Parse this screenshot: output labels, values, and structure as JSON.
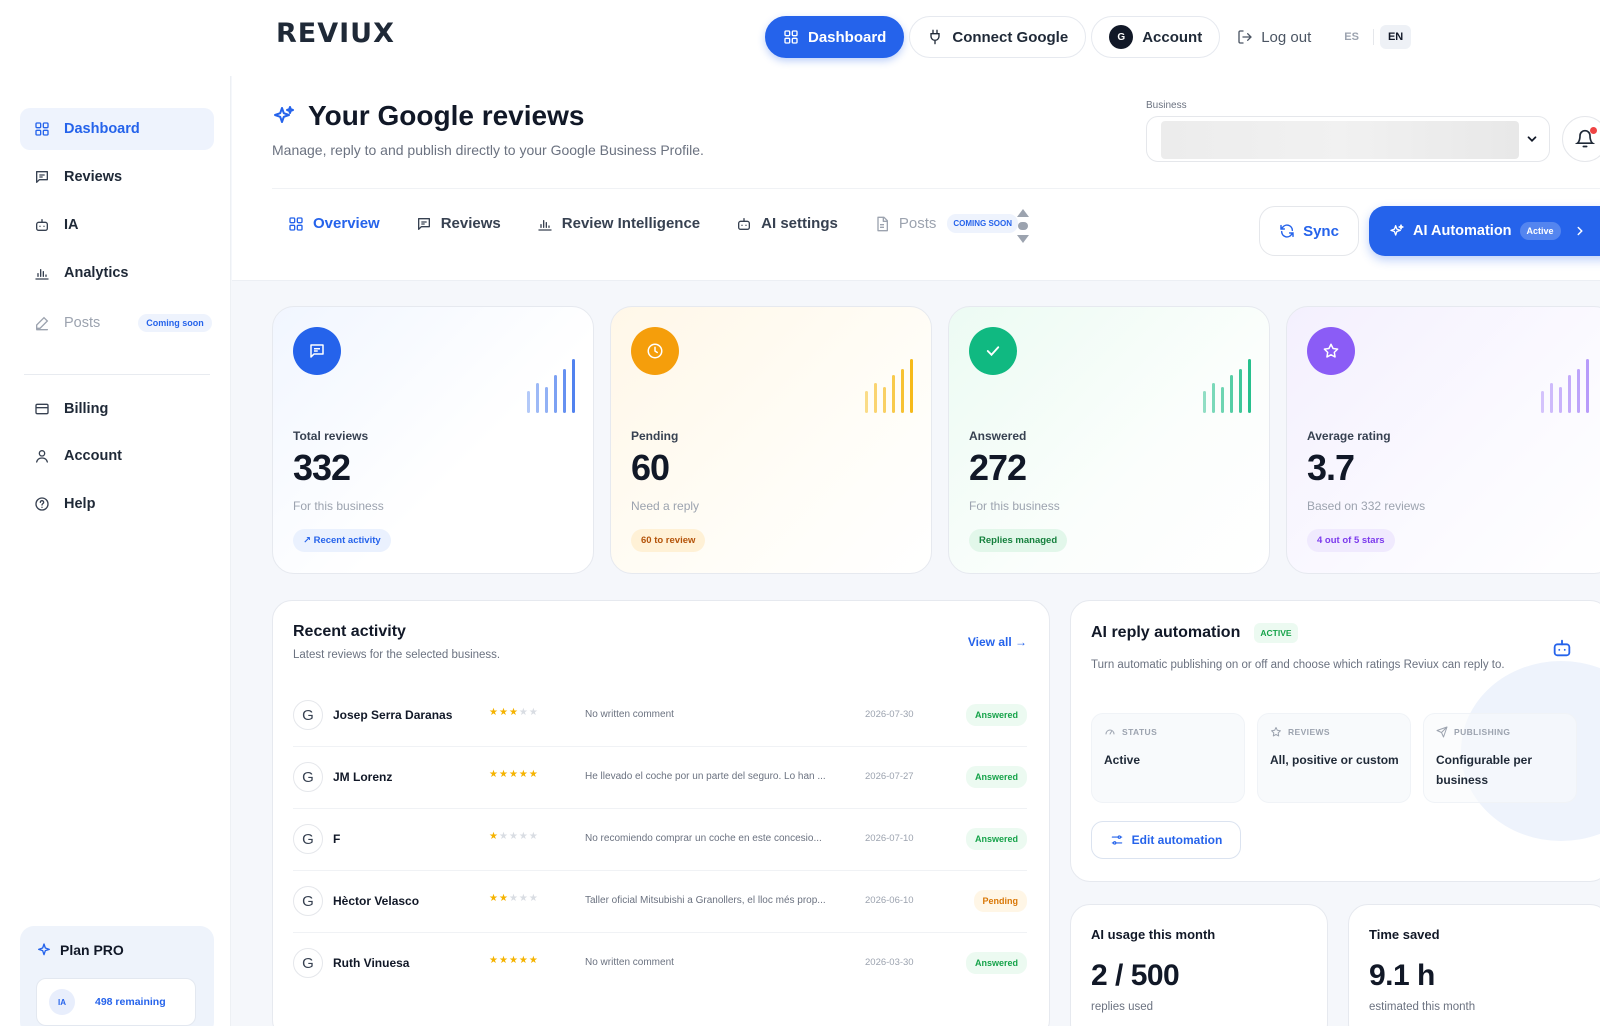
{
  "brand": {
    "logo": "REVIUX"
  },
  "topnav": {
    "dashboard": "Dashboard",
    "connect": "Connect Google",
    "account_avatar": "G",
    "account": "Account",
    "logout": "Log out",
    "lang_es": "ES",
    "lang_en": "EN",
    "active_lang": "EN"
  },
  "sidebar": {
    "items": [
      {
        "label": "Dashboard",
        "icon": "grid-icon",
        "active": true
      },
      {
        "label": "Reviews",
        "icon": "message-icon"
      },
      {
        "label": "IA",
        "icon": "robot-icon"
      },
      {
        "label": "Analytics",
        "icon": "bar-chart-icon"
      },
      {
        "label": "Posts",
        "icon": "pen-icon",
        "badge": "Coming soon",
        "disabled": true
      },
      {
        "label": "Billing",
        "icon": "card-icon"
      },
      {
        "label": "Account",
        "icon": "user-icon"
      },
      {
        "label": "Help",
        "icon": "help-icon"
      }
    ],
    "plan": {
      "title": "Plan PRO",
      "chip": "IA",
      "remaining": "498 remaining"
    }
  },
  "header": {
    "title": "Your Google reviews",
    "subtitle": "Manage, reply to and publish directly to your Google Business Profile.",
    "business_label": "Business"
  },
  "tabs": [
    {
      "label": "Overview",
      "icon": "grid-icon",
      "active": true
    },
    {
      "label": "Reviews",
      "icon": "message-icon"
    },
    {
      "label": "Review Intelligence",
      "icon": "bar-chart-icon"
    },
    {
      "label": "AI settings",
      "icon": "robot-icon"
    },
    {
      "label": "Posts",
      "icon": "document-icon",
      "badge": "COMING SOON",
      "disabled": true
    }
  ],
  "actions": {
    "sync": "Sync",
    "ai_automation": "AI Automation",
    "ai_status": "Active"
  },
  "stats": [
    {
      "label": "Total reviews",
      "value": "332",
      "sub": "For this business",
      "chip": "↗ Recent activity",
      "icon": "message-icon",
      "color": "#2563eb"
    },
    {
      "label": "Pending",
      "value": "60",
      "sub": "Need a reply",
      "chip": "60 to review",
      "icon": "clock-icon",
      "color": "#f59e0b"
    },
    {
      "label": "Answered",
      "value": "272",
      "sub": "For this business",
      "chip": "Replies managed",
      "icon": "check-icon",
      "color": "#10b981"
    },
    {
      "label": "Average rating",
      "value": "3.7",
      "sub": "Based on 332 reviews",
      "chip": "4 out of 5 stars",
      "icon": "star-icon",
      "color": "#8b5cf6"
    }
  ],
  "recent": {
    "title": "Recent activity",
    "subtitle": "Latest reviews for the selected business.",
    "view_all": "View all →",
    "rows": [
      {
        "avatar": "G",
        "name": "Josep Serra Daranas",
        "rating": 3,
        "comment": "No written comment",
        "date": "2026-07-30",
        "status": "Answered"
      },
      {
        "avatar": "G",
        "name": "JM Lorenz",
        "rating": 5,
        "comment": "He llevado el coche por un parte del seguro. Lo han ...",
        "date": "2026-07-27",
        "status": "Answered"
      },
      {
        "avatar": "G",
        "name": "F",
        "rating": 1,
        "comment": "No recomiendo comprar un coche en este concesio...",
        "date": "2026-07-10",
        "status": "Answered"
      },
      {
        "avatar": "G",
        "name": "Hèctor Velasco",
        "rating": 2,
        "comment": "Taller oficial Mitsubishi a Granollers, el lloc més prop...",
        "date": "2026-06-10",
        "status": "Pending"
      },
      {
        "avatar": "G",
        "name": "Ruth Vinuesa",
        "rating": 5,
        "comment": "No written comment",
        "date": "2026-03-30",
        "status": "Answered"
      }
    ]
  },
  "automation": {
    "title": "AI reply automation",
    "badge": "ACTIVE",
    "description": "Turn automatic publishing on or off and choose which ratings Reviux can reply to.",
    "boxes": [
      {
        "label": "STATUS",
        "value": "Active",
        "icon": "gauge-icon"
      },
      {
        "label": "REVIEWS",
        "value": "All, positive or custom",
        "icon": "star-icon"
      },
      {
        "label": "PUBLISHING",
        "value": "Configurable per business",
        "icon": "send-icon"
      }
    ],
    "edit": "Edit automation"
  },
  "usage": {
    "title": "AI usage this month",
    "value": "2 / 500",
    "sub": "replies used"
  },
  "time_saved": {
    "title": "Time saved",
    "value": "9.1 h",
    "sub": "estimated this month"
  }
}
